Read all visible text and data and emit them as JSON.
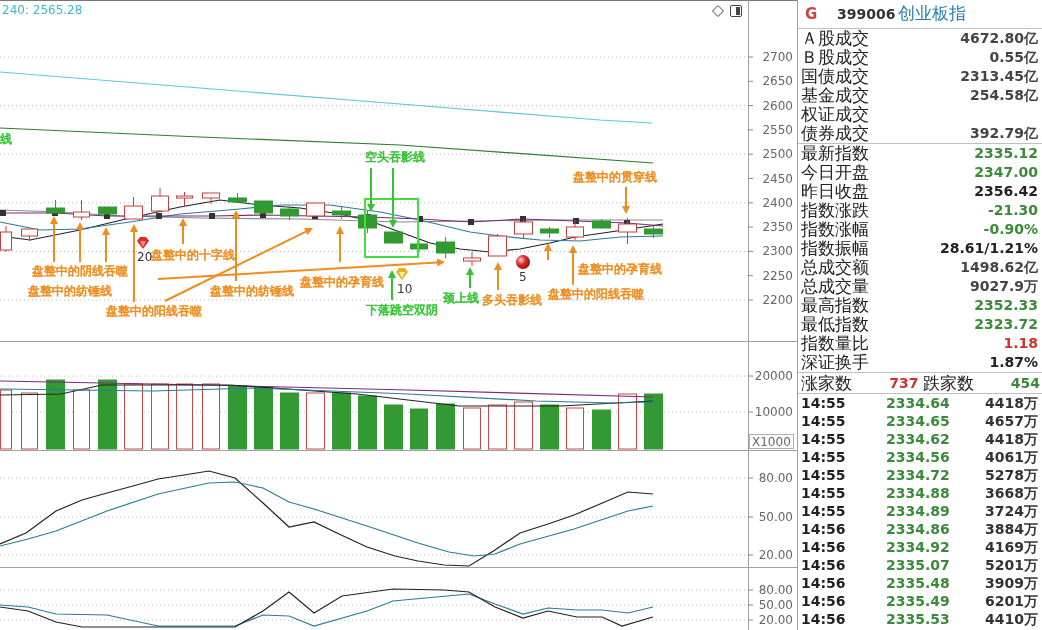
{
  "main_chart": {
    "legend": "240: 2565.28",
    "y_axis": [
      "2700",
      "2650",
      "2600",
      "2550",
      "2500",
      "2450",
      "2400",
      "2350",
      "2300",
      "2250",
      "2200"
    ],
    "annotations": [
      {
        "text": "线",
        "color": "#33c433"
      },
      {
        "text": "空头吞影线",
        "color": "#33c433"
      },
      {
        "text": "盘整中的贯穿线",
        "color": "#f08c1e"
      },
      {
        "text": "盘整中的十字线",
        "color": "#f08c1e"
      },
      {
        "text": "盘整中的阴线吞噬",
        "color": "#f08c1e"
      },
      {
        "text": "盘整中的孕育线",
        "color": "#f08c1e"
      },
      {
        "text": "盘整中的孕育线",
        "color": "#f08c1e"
      },
      {
        "text": "盘整中的纺锤线",
        "color": "#f08c1e"
      },
      {
        "text": "盘整中的纺锤线",
        "color": "#f08c1e"
      },
      {
        "text": "颈上线",
        "color": "#33c433"
      },
      {
        "text": "多头吞影线",
        "color": "#f08c1e"
      },
      {
        "text": "盘整中的阳线吞噬",
        "color": "#f08c1e"
      },
      {
        "text": "盘整中的阳线吞噬",
        "color": "#f08c1e"
      },
      {
        "text": "下落跳空双阴",
        "color": "#33c433"
      }
    ],
    "markers": [
      {
        "kind": "diamond",
        "label": "20"
      },
      {
        "kind": "gem",
        "label": "10"
      },
      {
        "kind": "ball",
        "label": "5"
      }
    ]
  },
  "volume_chart": {
    "y_axis": [
      "20000",
      "10000"
    ],
    "unit": "X1000"
  },
  "indicator_chart": {
    "y_axis": [
      "80.00",
      "50.00",
      "20.00"
    ]
  },
  "oscillator_chart": {
    "y_axis": [
      "80.00",
      "50.00",
      "20.00"
    ]
  },
  "quote": {
    "badge": "G",
    "code": "399006",
    "name": "创业板指",
    "turnover": [
      {
        "label": "Ａ股成交",
        "value": "4672.80亿"
      },
      {
        "label": "Ｂ股成交",
        "value": "0.55亿"
      },
      {
        "label": "国债成交",
        "value": "2313.45亿"
      },
      {
        "label": "基金成交",
        "value": "254.58亿"
      },
      {
        "label": "权证成交"
      },
      {
        "label": "债券成交",
        "value": "392.79亿"
      }
    ],
    "stats": [
      {
        "label": "最新指数",
        "value": "2335.12",
        "color": "#3a8a3a"
      },
      {
        "label": "今日开盘",
        "value": "2347.00",
        "color": "#3a8a3a"
      },
      {
        "label": "昨日收盘",
        "value": "2356.42",
        "color": "#222222"
      },
      {
        "label": "指数涨跌",
        "value": "-21.30",
        "color": "#3a8a3a"
      },
      {
        "label": "指数涨幅",
        "value": "-0.90%",
        "color": "#3a8a3a"
      },
      {
        "label": "指数振幅",
        "value": "28.61/1.21%",
        "color": "#222222"
      },
      {
        "label": "总成交额",
        "value": "1498.62亿",
        "color": "#444444"
      },
      {
        "label": "总成交量",
        "value": "9027.9万",
        "color": "#444444"
      },
      {
        "label": "最高指数",
        "value": "2352.33",
        "color": "#3a8a3a"
      },
      {
        "label": "最低指数",
        "value": "2323.72",
        "color": "#3a8a3a"
      },
      {
        "label": "指数量比",
        "value": "1.18",
        "color": "#cc3333"
      },
      {
        "label": "深证换手",
        "value": "1.87%",
        "color": "#222222"
      }
    ],
    "breadth": {
      "up_label": "涨家数",
      "up_count": "737",
      "down_label": "跌家数",
      "down_count": "454"
    },
    "ticks": [
      {
        "time": "14:55",
        "price": "2334.64",
        "volume": "4418万"
      },
      {
        "time": "14:55",
        "price": "2334.65",
        "volume": "4657万"
      },
      {
        "time": "14:55",
        "price": "2334.62",
        "volume": "4418万"
      },
      {
        "time": "14:55",
        "price": "2334.56",
        "volume": "4061万"
      },
      {
        "time": "14:55",
        "price": "2334.72",
        "volume": "5278万"
      },
      {
        "time": "14:55",
        "price": "2334.88",
        "volume": "3668万"
      },
      {
        "time": "14:55",
        "price": "2334.89",
        "volume": "3724万"
      },
      {
        "time": "14:56",
        "price": "2334.86",
        "volume": "3884万"
      },
      {
        "time": "14:56",
        "price": "2334.92",
        "volume": "4169万"
      },
      {
        "time": "14:56",
        "price": "2335.07",
        "volume": "5201万"
      },
      {
        "time": "14:56",
        "price": "2335.48",
        "volume": "3909万"
      },
      {
        "time": "14:56",
        "price": "2335.49",
        "volume": "6201万"
      },
      {
        "time": "14:56",
        "price": "2335.53",
        "volume": "4410万"
      }
    ]
  }
}
